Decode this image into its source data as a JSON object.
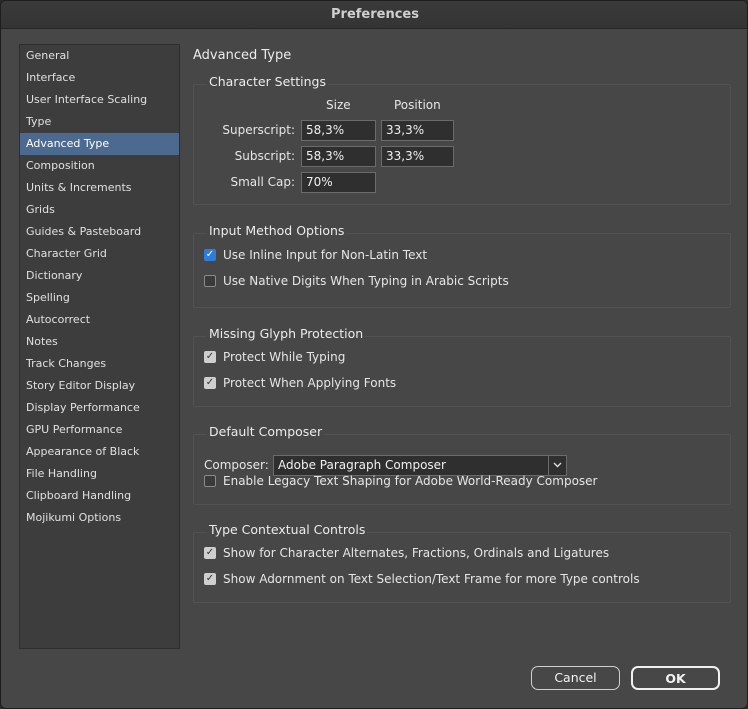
{
  "window": {
    "title": "Preferences"
  },
  "sidebar": {
    "selected_index": 4,
    "items": [
      "General",
      "Interface",
      "User Interface Scaling",
      "Type",
      "Advanced Type",
      "Composition",
      "Units & Increments",
      "Grids",
      "Guides & Pasteboard",
      "Character Grid",
      "Dictionary",
      "Spelling",
      "Autocorrect",
      "Notes",
      "Track Changes",
      "Story Editor Display",
      "Display Performance",
      "GPU Performance",
      "Appearance of Black",
      "File Handling",
      "Clipboard Handling",
      "Mojikumi Options"
    ]
  },
  "panel": {
    "title": "Advanced Type"
  },
  "character_settings": {
    "title": "Character Settings",
    "col_size": "Size",
    "col_position": "Position",
    "superscript_label": "Superscript:",
    "superscript_size": "58,3%",
    "superscript_position": "33,3%",
    "subscript_label": "Subscript:",
    "subscript_size": "58,3%",
    "subscript_position": "33,3%",
    "smallcap_label": "Small Cap:",
    "smallcap_size": "70%"
  },
  "input_method": {
    "title": "Input Method Options",
    "inline_input_label": "Use Inline Input for Non-Latin Text",
    "inline_input_checked": true,
    "native_digits_label": "Use Native Digits When Typing in Arabic Scripts",
    "native_digits_checked": false
  },
  "missing_glyph": {
    "title": "Missing Glyph Protection",
    "typing_label": "Protect While Typing",
    "typing_checked": true,
    "fonts_label": "Protect When Applying Fonts",
    "fonts_checked": true
  },
  "default_composer": {
    "title": "Default Composer",
    "composer_label": "Composer:",
    "composer_value": "Adobe Paragraph Composer",
    "legacy_label": "Enable Legacy Text Shaping for Adobe World-Ready Composer",
    "legacy_checked": false
  },
  "type_contextual": {
    "title": "Type Contextual Controls",
    "alternates_label": "Show for Character Alternates, Fractions, Ordinals and Ligatures",
    "alternates_checked": true,
    "adornment_label": "Show Adornment on Text Selection/Text Frame for more Type controls",
    "adornment_checked": true
  },
  "buttons": {
    "cancel": "Cancel",
    "ok": "OK"
  },
  "colors": {
    "accent": "#2f7ddb",
    "selection": "#4c6a8f",
    "background": "#474747"
  },
  "icons": {
    "checkmark": "check-icon",
    "dropdown": "chevron-down-icon"
  }
}
